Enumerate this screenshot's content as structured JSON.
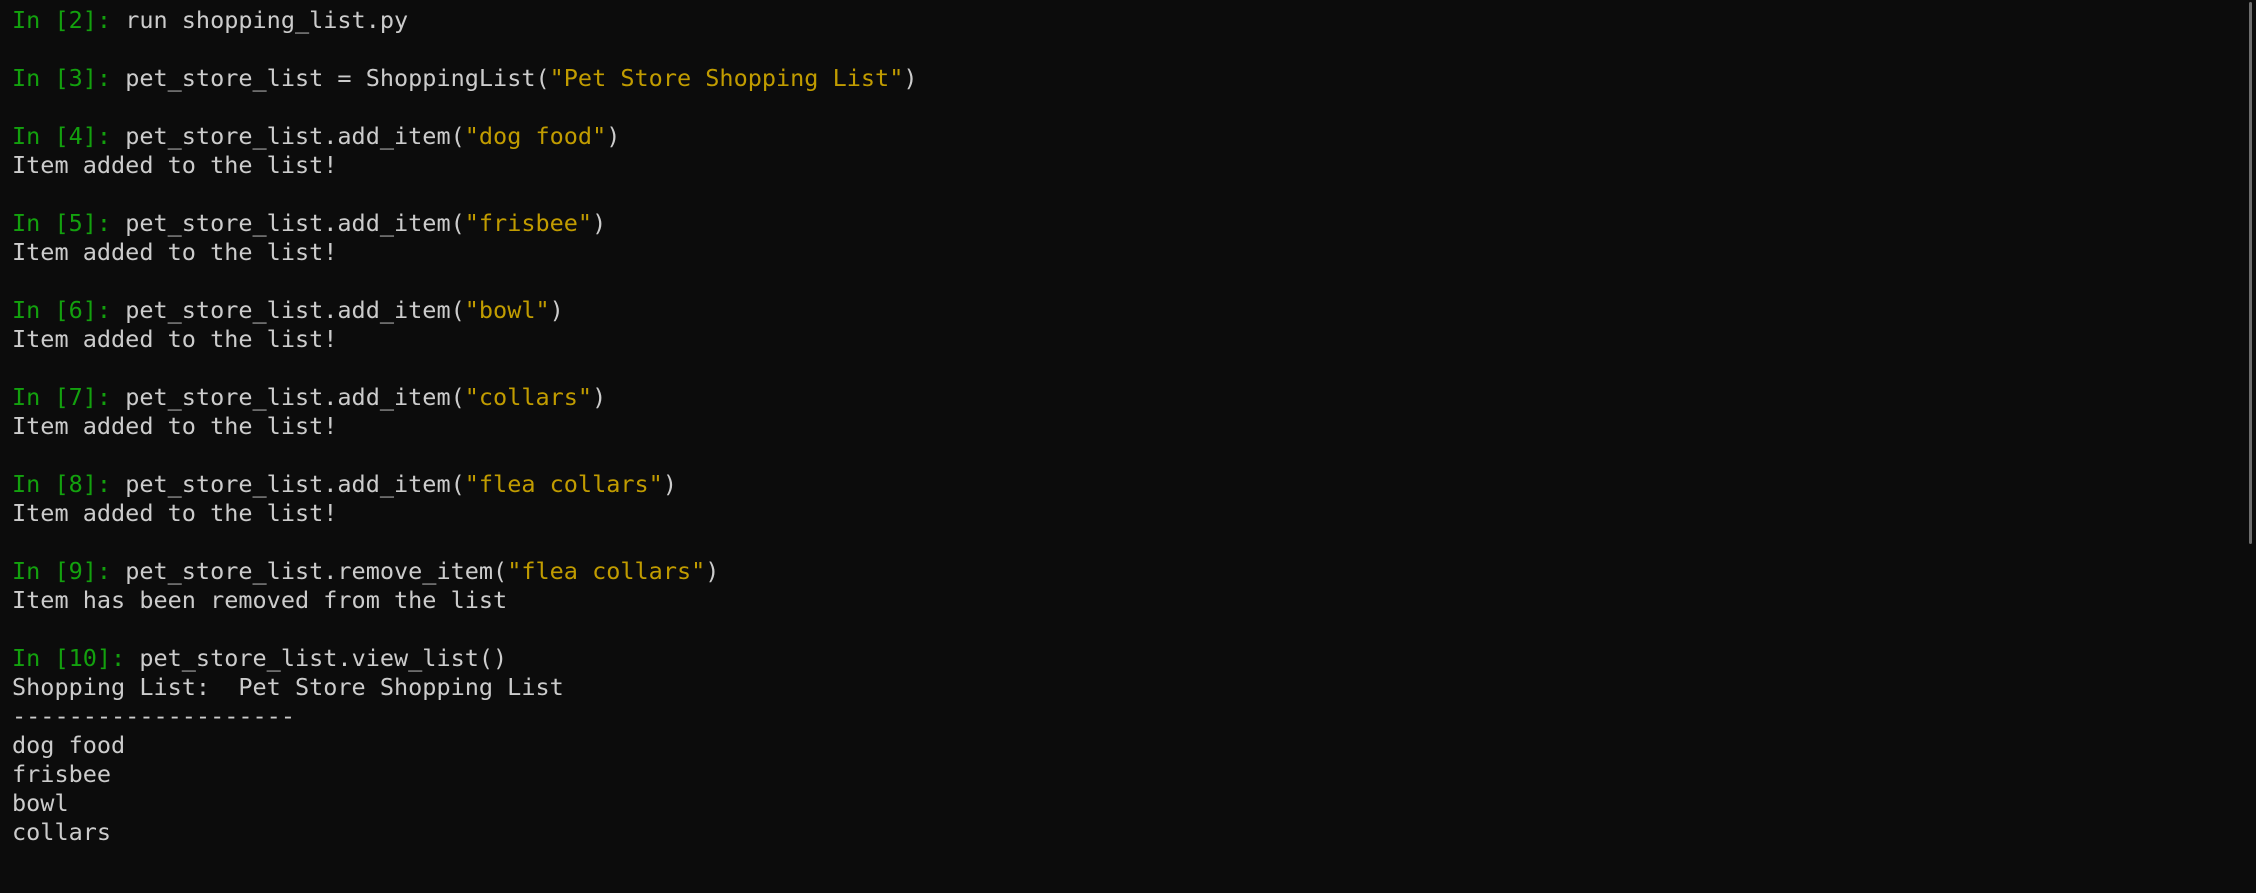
{
  "colors": {
    "background": "#0c0c0c",
    "prompt": "#13a10e",
    "text": "#cccccc",
    "string": "#c19c00",
    "scrollbar_thumb": "#6e6e6e"
  },
  "cells": [
    {
      "prompt": "In [2]: ",
      "code_before": "run shopping_list.py",
      "string": "",
      "code_after": "",
      "output": []
    },
    {
      "prompt": "In [3]: ",
      "code_before": "pet_store_list = ShoppingList(",
      "string": "\"Pet Store Shopping List\"",
      "code_after": ")",
      "output": []
    },
    {
      "prompt": "In [4]: ",
      "code_before": "pet_store_list.add_item(",
      "string": "\"dog food\"",
      "code_after": ")",
      "output": [
        "Item added to the list!"
      ]
    },
    {
      "prompt": "In [5]: ",
      "code_before": "pet_store_list.add_item(",
      "string": "\"frisbee\"",
      "code_after": ")",
      "output": [
        "Item added to the list!"
      ]
    },
    {
      "prompt": "In [6]: ",
      "code_before": "pet_store_list.add_item(",
      "string": "\"bowl\"",
      "code_after": ")",
      "output": [
        "Item added to the list!"
      ]
    },
    {
      "prompt": "In [7]: ",
      "code_before": "pet_store_list.add_item(",
      "string": "\"collars\"",
      "code_after": ")",
      "output": [
        "Item added to the list!"
      ]
    },
    {
      "prompt": "In [8]: ",
      "code_before": "pet_store_list.add_item(",
      "string": "\"flea collars\"",
      "code_after": ")",
      "output": [
        "Item added to the list!"
      ]
    },
    {
      "prompt": "In [9]: ",
      "code_before": "pet_store_list.remove_item(",
      "string": "\"flea collars\"",
      "code_after": ")",
      "output": [
        "Item has been removed from the list"
      ]
    },
    {
      "prompt": "In [10]: ",
      "code_before": "pet_store_list.view_list()",
      "string": "",
      "code_after": "",
      "output": [
        "Shopping List:  Pet Store Shopping List",
        "--------------------",
        "dog food",
        "frisbee",
        "bowl",
        "collars"
      ]
    }
  ]
}
